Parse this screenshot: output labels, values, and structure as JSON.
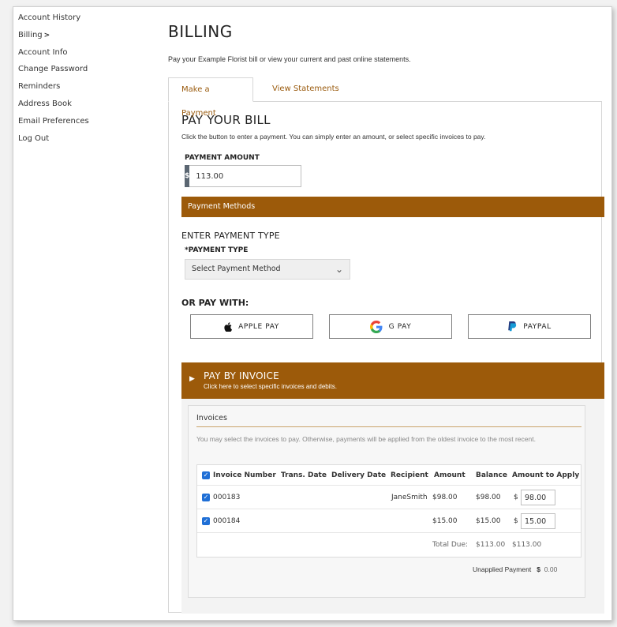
{
  "sidebar": {
    "items": [
      {
        "label": "Account History"
      },
      {
        "label": "Billing",
        "chevron": ">"
      },
      {
        "label": "Account Info"
      },
      {
        "label": "Change Password"
      },
      {
        "label": "Reminders"
      },
      {
        "label": "Address Book"
      },
      {
        "label": "Email Preferences"
      },
      {
        "label": "Log Out"
      }
    ]
  },
  "page": {
    "title": "BILLING",
    "intro": "Pay your Example Florist bill or view your current and past online statements."
  },
  "tabs": [
    {
      "label": "Make a Payment",
      "active": true
    },
    {
      "label": "View Statements",
      "active": false
    }
  ],
  "payment": {
    "title": "PAY YOUR BILL",
    "subtitle": "Click the button to enter a payment. You can simply enter an amount, or select specific invoices to pay.",
    "amount_label": "PAYMENT AMOUNT",
    "currency_symbol": "$",
    "amount_value": "113.00"
  },
  "methods": {
    "bar_label": "Payment Methods",
    "enter_type_title": "ENTER PAYMENT TYPE",
    "type_label": "*PAYMENT TYPE",
    "type_selected": "Select Payment Method",
    "or_pay_with": "OR PAY WITH:",
    "buttons": [
      {
        "label": "APPLE PAY",
        "icon": "apple-icon"
      },
      {
        "label": "G PAY",
        "icon": "google-icon"
      },
      {
        "label": "PAYPAL",
        "icon": "paypal-icon"
      }
    ]
  },
  "invoice_section": {
    "title": "PAY BY INVOICE",
    "subtitle": "Click here to select specific invoices and debits.",
    "card_title": "Invoices",
    "note": "You may select the invoices to pay. Otherwise, payments will be applied from the oldest invoice to the most recent.",
    "columns": [
      "Invoice Number",
      "Trans. Date",
      "Delivery Date",
      "Recipient",
      "Amount",
      "Balance",
      "Amount to Apply"
    ],
    "rows": [
      {
        "invoice": "000183",
        "trans_date": "",
        "delivery_date": "",
        "recipient": "JaneSmith",
        "amount": "$98.00",
        "balance": "$98.00",
        "apply_symbol": "$",
        "apply_value": "98.00"
      },
      {
        "invoice": "000184",
        "trans_date": "",
        "delivery_date": "",
        "recipient": "",
        "amount": "$15.00",
        "balance": "$15.00",
        "apply_symbol": "$",
        "apply_value": "15.00"
      }
    ],
    "total_label": "Total Due:",
    "total_balance": "$113.00",
    "total_apply": "$113.00",
    "unapplied_label": "Unapplied Payment",
    "unapplied_symbol": "$",
    "unapplied_value": "0.00"
  },
  "colors": {
    "brand_brown": "#9c5a0a",
    "tab_text": "#9a5b0e",
    "checkbox_blue": "#1f6fd6",
    "prefix_gray": "#5b6672"
  }
}
